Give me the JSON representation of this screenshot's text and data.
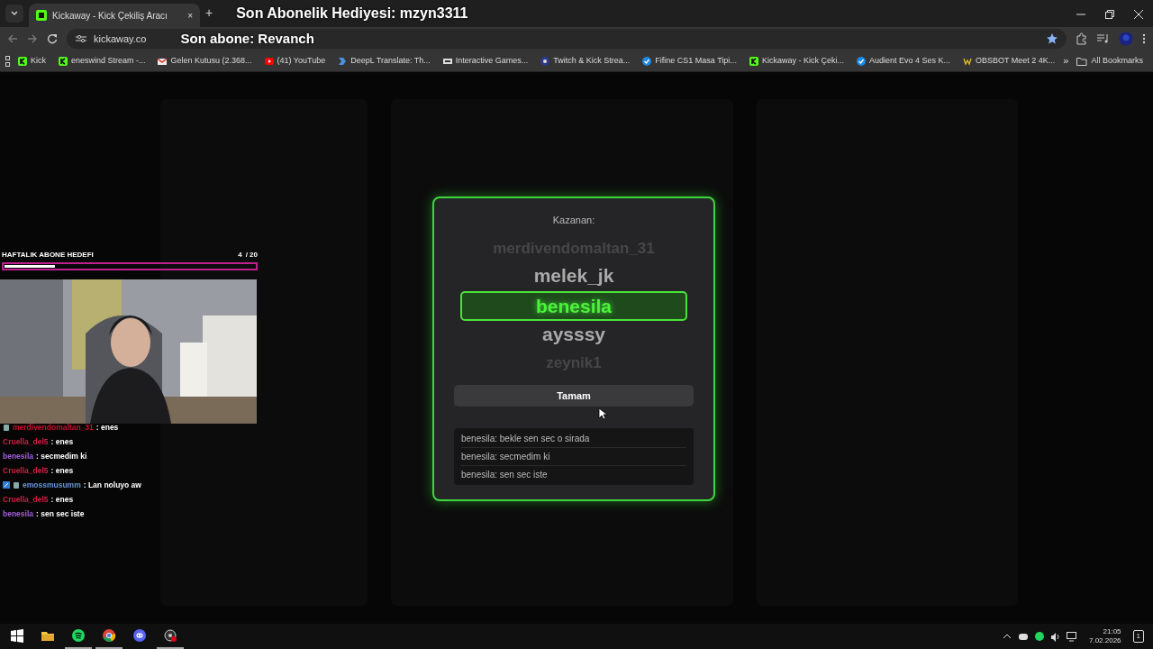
{
  "browser": {
    "tab": {
      "title": "Kickaway - Kick Çekiliş Aracı",
      "close": "×",
      "new_tab": "+"
    },
    "url": "kickaway.co",
    "bookmarks": [
      {
        "label": "Kick",
        "kind": "kick"
      },
      {
        "label": "eneswind Stream -...",
        "kind": "kick"
      },
      {
        "label": "Gelen Kutusu (2.368...",
        "kind": "mail"
      },
      {
        "label": "(41) YouTube",
        "kind": "video"
      },
      {
        "label": "DeepL Translate: Th...",
        "kind": "translate"
      },
      {
        "label": "Interactive Games...",
        "kind": "game"
      },
      {
        "label": "Twitch & Kick Strea...",
        "kind": "cp"
      },
      {
        "label": "Fifine CS1 Masa Tipi...",
        "kind": "check"
      },
      {
        "label": "Kickaway - Kick Çeki...",
        "kind": "kick"
      },
      {
        "label": "Audient Evo 4 Ses K...",
        "kind": "check"
      },
      {
        "label": "OBSBOT Meet 2 4K...",
        "kind": "w"
      }
    ],
    "more": "»",
    "all_bookmarks": "All Bookmarks"
  },
  "stream_overlay": {
    "last_gift": "Son Abonelik Hediyesi: mzyn3311",
    "last_sub": "Son abone: Revanch",
    "goal": {
      "title": "HAFTALIK ABONE HEDEFI",
      "current": "4",
      "target": "/ 20",
      "level": 0.2
    },
    "chat": [
      {
        "user": "merdivendomaltan_31",
        "message": ": enes",
        "color": "#c8102e",
        "kind": "subscriber"
      },
      {
        "user": "Cruella_del5",
        "message": ": enes",
        "color": "#d11f43",
        "kind": "plain"
      },
      {
        "user": "benesila",
        "message": ": secmedim ki",
        "color": "#a35ee0",
        "kind": "plain"
      },
      {
        "user": "Cruella_del5",
        "message": ": enes",
        "color": "#d11f43",
        "kind": "plain"
      },
      {
        "user": "emossmusumm",
        "message": ": Lan noluyo aw",
        "color": "#6a94d8",
        "kind": "vip"
      },
      {
        "user": "Cruella_del5",
        "message": ": enes",
        "color": "#d11f43",
        "kind": "plain"
      },
      {
        "user": "benesila",
        "message": ": sen sec iste",
        "color": "#a35ee0",
        "kind": "plain"
      }
    ]
  },
  "winner_modal": {
    "title": "Kazanan:",
    "reel": [
      {
        "name": "merdivendomaltan_31",
        "kind": "far",
        "selected": false
      },
      {
        "name": "melek_jk",
        "kind": "near",
        "selected": false
      },
      {
        "name": "benesila",
        "kind": "near",
        "selected": true
      },
      {
        "name": "aysssy",
        "kind": "near",
        "selected": false
      },
      {
        "name": "zeynik1",
        "kind": "far",
        "selected": false
      }
    ],
    "button": "Tamam",
    "messages": [
      "benesila: bekle sen sec o sirada",
      "benesila: secmedim ki",
      "benesila: sen sec iste"
    ]
  },
  "taskbar": {
    "time": "21:05",
    "date": "7.02.2026",
    "apps": [
      {
        "kind": "windows",
        "active": false
      },
      {
        "kind": "folder",
        "active": false
      },
      {
        "kind": "music",
        "active": true
      },
      {
        "kind": "browser",
        "active": true
      },
      {
        "kind": "chat",
        "active": false
      },
      {
        "kind": "record",
        "active": true
      }
    ],
    "notifications": "1"
  }
}
